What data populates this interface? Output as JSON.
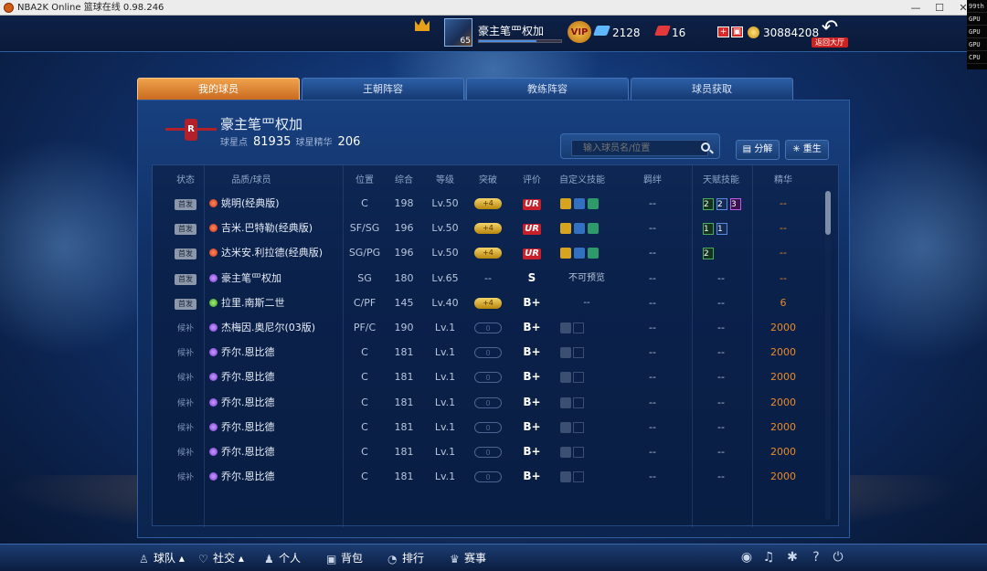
{
  "window": {
    "title": "NBA2K Online 篮球在线 0.98.246"
  },
  "perf": [
    "99th",
    "GPU",
    "GPU",
    "GPU",
    "CPU"
  ],
  "header": {
    "avatar_level": "65",
    "player_name": "豪主笔罒权加",
    "diamonds": "2128",
    "tickets": "16",
    "coins": "30884208",
    "back_label": "返回大厅",
    "vip_label": "VIP"
  },
  "tabs": [
    "我的球员",
    "王朝阵容",
    "教练阵容",
    "球员获取"
  ],
  "team": {
    "name": "豪主笔罒权加",
    "points_label": "球星点",
    "points": "81935",
    "essence_label": "球星精华",
    "essence": "206"
  },
  "search": {
    "placeholder": "输入球员名/位置"
  },
  "buttons": {
    "decompose": "分解",
    "rebirth": "重生"
  },
  "columns": [
    "状态",
    "品质/球员",
    "位置",
    "综合",
    "等级",
    "突破",
    "评价",
    "自定义技能",
    "羁绊",
    "天赋技能",
    "精华"
  ],
  "rows": [
    {
      "status": "首发",
      "quality": "red",
      "name": "姚明(经典版)",
      "pos": "C",
      "ovr": "198",
      "lv": "Lv.50",
      "break": "+4",
      "grade": "UR",
      "skills": [
        "y",
        "b",
        "g"
      ],
      "bond": "--",
      "talents": [
        {
          "v": "2",
          "c": "t-g"
        },
        {
          "v": "2",
          "c": "t-b"
        },
        {
          "v": "3",
          "c": "t-p"
        }
      ],
      "essence": "--"
    },
    {
      "status": "首发",
      "quality": "red",
      "name": "吉米.巴特勒(经典版)",
      "pos": "SF/SG",
      "ovr": "196",
      "lv": "Lv.50",
      "break": "+4",
      "grade": "UR",
      "skills": [
        "y",
        "b",
        "g"
      ],
      "bond": "--",
      "talents": [
        {
          "v": "1",
          "c": "t-g"
        },
        {
          "v": "1",
          "c": "t-b"
        }
      ],
      "essence": "--"
    },
    {
      "status": "首发",
      "quality": "red",
      "name": "达米安.利拉德(经典版)",
      "pos": "SG/PG",
      "ovr": "196",
      "lv": "Lv.50",
      "break": "+4",
      "grade": "UR",
      "skills": [
        "y",
        "b",
        "g"
      ],
      "bond": "--",
      "talents": [
        {
          "v": "2",
          "c": "t-g"
        }
      ],
      "essence": "--"
    },
    {
      "status": "首发",
      "quality": "purple",
      "name": "豪主笔罒权加",
      "pos": "SG",
      "ovr": "180",
      "lv": "Lv.65",
      "break": "--",
      "grade": "S",
      "skills_text": "不可预览",
      "bond": "--",
      "talents_text": "--",
      "essence": "--"
    },
    {
      "status": "首发",
      "quality": "green",
      "name": "拉里.南斯二世",
      "pos": "C/PF",
      "ovr": "145",
      "lv": "Lv.40",
      "break": "+4",
      "grade": "B+",
      "skills_text": "--",
      "bond": "--",
      "talents_text": "--",
      "essence": "6"
    },
    {
      "status": "候补",
      "quality": "purple",
      "name": "杰梅因.奥尼尔(03版)",
      "pos": "PF/C",
      "ovr": "190",
      "lv": "Lv.1",
      "break": "0",
      "grade": "B+",
      "locked": true,
      "bond": "--",
      "talents_text": "--",
      "essence": "2000"
    },
    {
      "status": "候补",
      "quality": "purple",
      "name": "乔尔.恩比德",
      "pos": "C",
      "ovr": "181",
      "lv": "Lv.1",
      "break": "0",
      "grade": "B+",
      "locked": true,
      "bond": "--",
      "talents_text": "--",
      "essence": "2000"
    },
    {
      "status": "候补",
      "quality": "purple",
      "name": "乔尔.恩比德",
      "pos": "C",
      "ovr": "181",
      "lv": "Lv.1",
      "break": "0",
      "grade": "B+",
      "locked": true,
      "bond": "--",
      "talents_text": "--",
      "essence": "2000"
    },
    {
      "status": "候补",
      "quality": "purple",
      "name": "乔尔.恩比德",
      "pos": "C",
      "ovr": "181",
      "lv": "Lv.1",
      "break": "0",
      "grade": "B+",
      "locked": true,
      "bond": "--",
      "talents_text": "--",
      "essence": "2000"
    },
    {
      "status": "候补",
      "quality": "purple",
      "name": "乔尔.恩比德",
      "pos": "C",
      "ovr": "181",
      "lv": "Lv.1",
      "break": "0",
      "grade": "B+",
      "locked": true,
      "bond": "--",
      "talents_text": "--",
      "essence": "2000"
    },
    {
      "status": "候补",
      "quality": "purple",
      "name": "乔尔.恩比德",
      "pos": "C",
      "ovr": "181",
      "lv": "Lv.1",
      "break": "0",
      "grade": "B+",
      "locked": true,
      "bond": "--",
      "talents_text": "--",
      "essence": "2000"
    },
    {
      "status": "候补",
      "quality": "purple",
      "name": "乔尔.恩比德",
      "pos": "C",
      "ovr": "181",
      "lv": "Lv.1",
      "break": "0",
      "grade": "B+",
      "locked": true,
      "bond": "--",
      "talents_text": "--",
      "essence": "2000"
    }
  ],
  "bottom_nav": [
    {
      "label": "球队",
      "icon": "user-icon"
    },
    {
      "label": "社交",
      "icon": "heart-icon"
    },
    {
      "label": "个人",
      "icon": "person-icon"
    },
    {
      "label": "背包",
      "icon": "bag-icon"
    },
    {
      "label": "排行",
      "icon": "rank-icon"
    },
    {
      "label": "赛事",
      "icon": "trophy-icon"
    }
  ],
  "colors": {
    "active_tab": "#e08a36",
    "essence": "#e88a2a",
    "ur": "#c8202a"
  }
}
